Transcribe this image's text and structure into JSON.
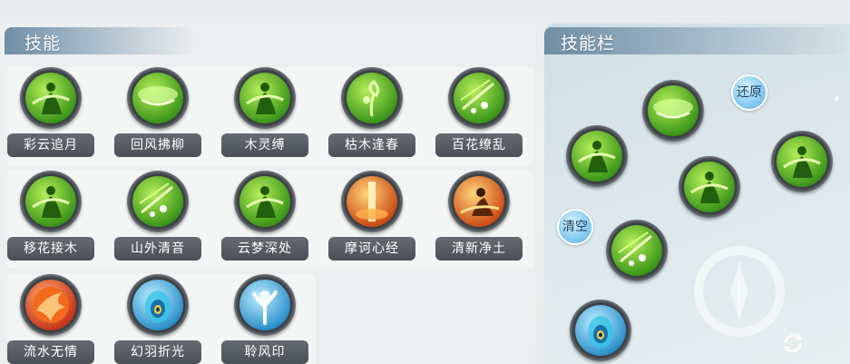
{
  "skills_panel": {
    "title": "技能",
    "skills": [
      {
        "name": "彩云追月",
        "icon": "green-dancer-icon",
        "color": "#3fae1f"
      },
      {
        "name": "回风拂柳",
        "icon": "green-wind-slash-icon",
        "color": "#4fb52a"
      },
      {
        "name": "木灵缚",
        "icon": "green-figure-bind-icon",
        "color": "#3ea31c"
      },
      {
        "name": "枯木逢春",
        "icon": "green-sprout-icon",
        "color": "#57b830"
      },
      {
        "name": "百花缭乱",
        "icon": "green-petals-icon",
        "color": "#4db22a"
      },
      {
        "name": "移花接木",
        "icon": "green-leap-icon",
        "color": "#3aa61d"
      },
      {
        "name": "山外清音",
        "icon": "green-music-burst-icon",
        "color": "#5cc12c"
      },
      {
        "name": "云梦深处",
        "icon": "green-dash-icon",
        "color": "#3ca31d"
      },
      {
        "name": "摩诃心经",
        "icon": "orange-light-pillar-icon",
        "color": "#e36a10"
      },
      {
        "name": "清新净土",
        "icon": "orange-figure-icon",
        "color": "#d9540c"
      },
      {
        "name": "流水无情",
        "icon": "red-flame-orb-icon",
        "color": "#e8461a"
      },
      {
        "name": "幻羽折光",
        "icon": "peacock-feather-icon",
        "color": "#2d8fd0"
      },
      {
        "name": "聆风印",
        "icon": "blue-tree-icon",
        "color": "#3ba7d8"
      }
    ]
  },
  "skill_bar": {
    "title": "技能栏",
    "restore_label": "还原",
    "clear_label": "清空",
    "slots": [
      {
        "icon": "green-wind-slash-icon"
      },
      {
        "icon": "green-dancer-icon"
      },
      {
        "icon": "green-figure-bind-icon"
      },
      {
        "icon": "green-dash-icon"
      },
      {
        "icon": "green-petals-icon"
      },
      {
        "icon": "peacock-feather-icon"
      }
    ]
  }
}
